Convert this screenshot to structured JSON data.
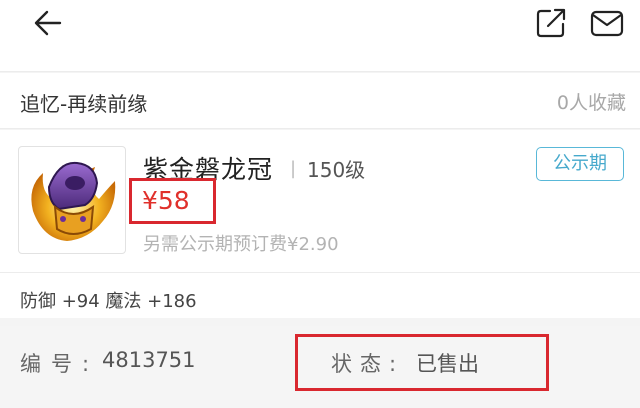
{
  "header": {
    "back_icon": "arrow-left-icon",
    "share_icon": "share-external-icon",
    "mail_icon": "mail-icon"
  },
  "server": {
    "name": "追忆-再续前缘",
    "favorites": "0人收藏"
  },
  "item": {
    "name": "紫金磐龙冠",
    "separator": "|",
    "level": "150级",
    "phase_badge": "公示期",
    "price": "¥58",
    "deposit_note": "另需公示期预订费¥2.90",
    "image_icon": "purple-gold-dragon-crown-icon"
  },
  "attributes": {
    "text": "防御 +94 魔法 +186"
  },
  "info": {
    "id_label": "编号:",
    "id_value": "4813751",
    "status_label": "状态:",
    "status_value": "已售出"
  },
  "colors": {
    "accent_red": "#e0302b",
    "highlight_box": "#d9282f",
    "badge_blue": "#46a9cc"
  }
}
